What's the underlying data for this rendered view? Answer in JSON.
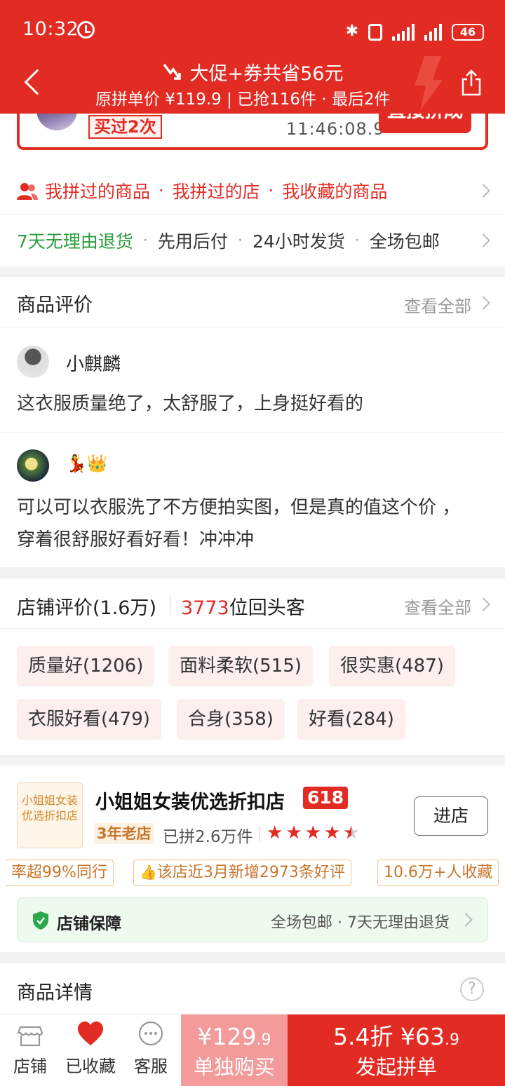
{
  "status_bar": {
    "time": "10:32",
    "battery": "46"
  },
  "header": {
    "promo": "大促+券共省56元",
    "sub": "原拼单价 ¥119.9 | 已抢116件 · 最后2件"
  },
  "group_buy": {
    "bought_times": "买过2次",
    "countdown": "11:46:08.9",
    "direct_button": "直接拼成"
  },
  "quick_links": {
    "items": [
      "我拼过的商品",
      "我拼过的店",
      "我收藏的商品"
    ]
  },
  "services": {
    "items": [
      "7天无理由退货",
      "先用后付",
      "24小时发货",
      "全场包邮"
    ],
    "highlight_color": "#2a9d3c"
  },
  "product_reviews": {
    "title": "商品评价",
    "see_all": "查看全部",
    "reviews": [
      {
        "name": "小麒麟",
        "text": "这衣服质量绝了，太舒服了，上身挺好看的"
      },
      {
        "name_emoji": "💃👑",
        "text": "可以可以衣服洗了不方便拍实图，但是真的值这个价 ，穿着很舒服好看好看！冲冲冲"
      }
    ]
  },
  "shop_reviews": {
    "title": "店铺评价(1.6万)",
    "returners_num": "3773",
    "returners_suffix": "位回头客",
    "see_all": "查看全部",
    "tags": [
      "质量好(1206)",
      "面料柔软(515)",
      "很实惠(487)",
      "衣服好看(479)",
      "合身(358)",
      "好看(284)"
    ]
  },
  "shop": {
    "logo_text": "小姐姐女装优选折扣店",
    "name": "小姐姐女装优选折扣店",
    "badge": "618",
    "age": "3年老店",
    "sold": "已拼2.6万件",
    "rating_stars": 4.5,
    "enter": "进店",
    "chips": [
      "率超99%同行",
      "该店近3月新增2973条好评",
      "10.6万+人收藏"
    ],
    "guarantee_title": "店铺保障",
    "guarantee_items": "全场包邮 · 7天无理由退货"
  },
  "details": {
    "title": "商品详情",
    "help": "?"
  },
  "bottom_bar": {
    "tabs": [
      "店铺",
      "已收藏",
      "客服"
    ],
    "solo_price": "¥129",
    "solo_price_dec": ".9",
    "solo_label": "单独购买",
    "group_discount_price": "5.4折 ¥63",
    "group_price_dec": ".9",
    "group_label": "发起拼单"
  },
  "colors": {
    "brand_red": "#e22b22",
    "solo_pink": "#f39a9a"
  }
}
